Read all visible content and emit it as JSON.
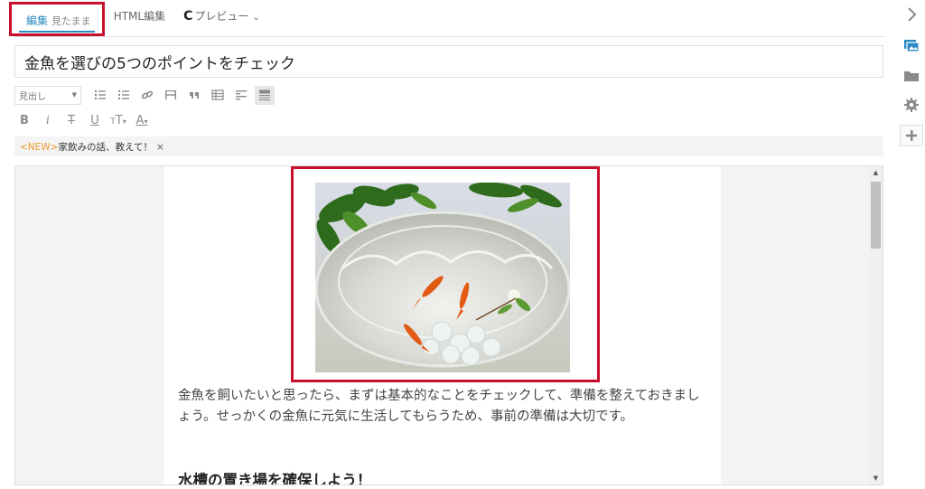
{
  "tabs": [
    {
      "label": "編集",
      "sub": "見たまま"
    },
    {
      "label": "HTML編集"
    },
    {
      "label": "プレビュー"
    }
  ],
  "title": {
    "value": "金魚を選びの5つのポイントをチェック"
  },
  "toolbar": {
    "heading_select": "見出し"
  },
  "notice": {
    "new_tag": "<NEW>",
    "text": "家飲みの話、教えて！",
    "close": "×"
  },
  "content": {
    "paragraph": "金魚を飼いたいと思ったら、まずは基本的なことをチェックして、準備を整えておきましょう。せっかくの金魚に元気に生活してもらうため、事前の準備は大切です。",
    "heading": "水槽の置き場を確保しよう！"
  },
  "colors": {
    "accent": "#2a8ac2",
    "highlight": "#c8102e",
    "new": "#e89a2e"
  },
  "icons": [
    "refresh-icon",
    "chevron-down-icon",
    "bullet-list-icon",
    "numbered-list-icon",
    "link-icon",
    "horizontal-rule-icon",
    "quote-icon",
    "table-icon",
    "align-icon",
    "block-icon",
    "bold-icon",
    "italic-icon",
    "strikethrough-icon",
    "underline-icon",
    "font-size-icon",
    "font-color-icon",
    "chevron-right-icon",
    "image-icon",
    "folder-icon",
    "gear-icon",
    "plus-icon"
  ]
}
